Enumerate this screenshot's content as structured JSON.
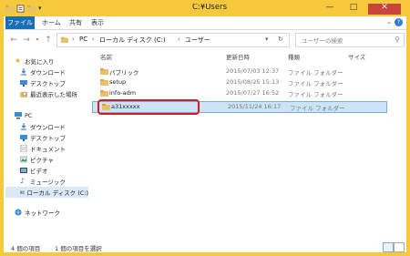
{
  "window": {
    "title": "C:¥Users"
  },
  "ribbon": {
    "tabs": [
      "ファイル",
      "ホーム",
      "共有",
      "表示"
    ]
  },
  "address": {
    "crumbs": [
      "PC",
      "ローカル ディスク (C:)",
      "ユーザー"
    ]
  },
  "search": {
    "placeholder": "ユーザーの検索"
  },
  "navpane": {
    "favorites_label": "お気に入り",
    "favorites": [
      "ダウンロード",
      "デスクトップ",
      "最近表示した場所"
    ],
    "pc_label": "PC",
    "pc_items": [
      "ダウンロード",
      "デスクトップ",
      "ドキュメント",
      "ピクチャ",
      "ビデオ",
      "ミュージック",
      "ローカル ディスク (C:)"
    ],
    "network_label": "ネットワーク"
  },
  "columns": {
    "name": "名前",
    "date": "更新日時",
    "type": "種類",
    "size": "サイズ"
  },
  "files": [
    {
      "name": "パブリック",
      "date": "2015/07/03 12:37",
      "type": "ファイル フォルダー"
    },
    {
      "name": "setup",
      "date": "2015/08/25 15:13",
      "type": "ファイル フォルダー"
    },
    {
      "name": "info-adm",
      "date": "2015/07/27 16:52",
      "type": "ファイル フォルダー"
    },
    {
      "name": "a31xxxxx",
      "date": "2015/11/24 16:17",
      "type": "ファイル フォルダー"
    }
  ],
  "status": {
    "count": "4 個の項目",
    "selected": "1 個の項目を選択"
  }
}
